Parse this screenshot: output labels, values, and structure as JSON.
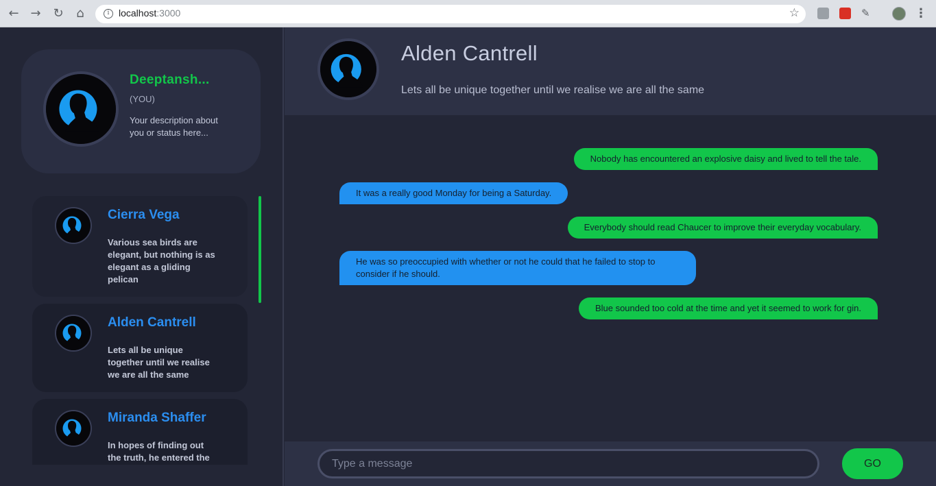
{
  "browser": {
    "url_host": "localhost",
    "url_port": ":3000",
    "icons": [
      "back-icon",
      "forward-icon",
      "reload-icon",
      "home-icon",
      "info-icon",
      "star-icon",
      "extension-icon",
      "profile-icon",
      "menu-icon"
    ]
  },
  "me": {
    "name": "Deeptansh...",
    "you_label": "(YOU)",
    "description": "Your description about you or status here..."
  },
  "contacts": [
    {
      "name": "Cierra Vega",
      "description": "Various sea birds are elegant, but nothing is as elegant as a gliding pelican"
    },
    {
      "name": "Alden Cantrell",
      "description": "Lets all be unique together until we realise we are all the same"
    },
    {
      "name": "Miranda Shaffer",
      "description": "In hopes of finding out the truth, he entered the"
    }
  ],
  "chat": {
    "name": "Alden Cantrell",
    "status": "Lets all be unique together until we realise we are all the same",
    "messages": [
      {
        "direction": "sent",
        "text": "Nobody has encountered an explosive daisy and lived to tell the tale."
      },
      {
        "direction": "received",
        "text": "It was a really good Monday for being a Saturday."
      },
      {
        "direction": "sent",
        "text": "Everybody should read Chaucer to improve their everyday vocabulary."
      },
      {
        "direction": "received",
        "text": "He was so preoccupied with whether or not he could that he failed to stop to consider if he should."
      },
      {
        "direction": "sent",
        "text": "Blue sounded too cold at the time and yet it seemed to work for gin."
      }
    ]
  },
  "composer": {
    "placeholder": "Type a message",
    "send_label": "GO"
  },
  "colors": {
    "accent_green": "#12c64a",
    "accent_blue": "#2291f0",
    "background": "#232636",
    "panel": "#2d3145"
  }
}
